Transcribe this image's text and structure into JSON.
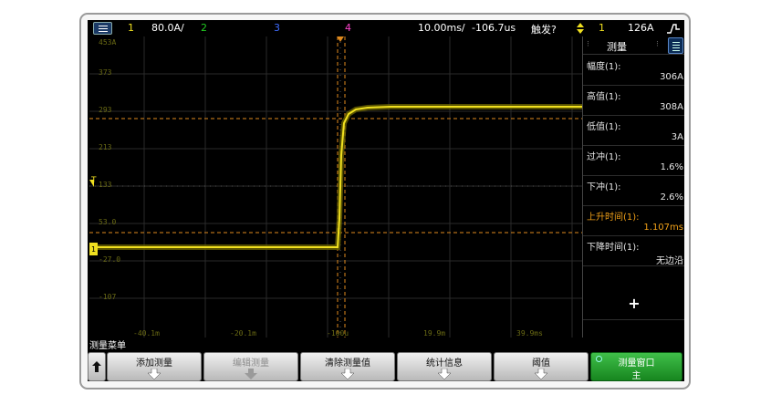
{
  "topbar": {
    "ch1_num": "1",
    "ch1_scale": "80.0A/",
    "ch2_num": "2",
    "ch3_num": "3",
    "ch4_num": "4",
    "timebase": "10.00ms/",
    "delay": "-106.7us",
    "trigger_label": "触发?",
    "trigger_ch": "1",
    "trigger_level": "126A"
  },
  "plot": {
    "y_labels": [
      "453A",
      "373",
      "293",
      "213",
      "133",
      "53.0",
      "-27.0",
      "-107"
    ],
    "x_labels": [
      "-40.1m",
      "-20.1m",
      "-100u",
      "19.9m",
      "39.9ms"
    ],
    "trigger_marker": "T"
  },
  "measure_panel": {
    "title": "测量",
    "items": [
      {
        "name": "幅度(1):",
        "value": "306A",
        "highlight": false
      },
      {
        "name": "高值(1):",
        "value": "308A",
        "highlight": false
      },
      {
        "name": "低值(1):",
        "value": "3A",
        "highlight": false
      },
      {
        "name": "过冲(1):",
        "value": "1.6%",
        "highlight": false
      },
      {
        "name": "下冲(1):",
        "value": "2.6%",
        "highlight": false
      },
      {
        "name": "上升时间(1):",
        "value": "1.107ms",
        "highlight": true
      },
      {
        "name": "下降时间(1):",
        "value": "无边沿",
        "highlight": false
      }
    ],
    "add_label": "+"
  },
  "menu_title": "测量菜单",
  "softkeys": [
    {
      "label": "添加测量",
      "disabled": false
    },
    {
      "label": "编辑测量",
      "disabled": true
    },
    {
      "label": "清除测量值",
      "disabled": false
    },
    {
      "label": "统计信息",
      "disabled": false
    },
    {
      "label": "阈值",
      "disabled": false
    }
  ],
  "window_key": {
    "label": "测量窗口",
    "sub": "主"
  },
  "colors": {
    "ch1": "#f0e020",
    "ch2": "#22cc22",
    "ch3": "#3f6cff",
    "ch4": "#ff44cc",
    "marker": "#e08a1e",
    "highlight": "#f0a018",
    "softkey_green": "#17861f"
  }
}
